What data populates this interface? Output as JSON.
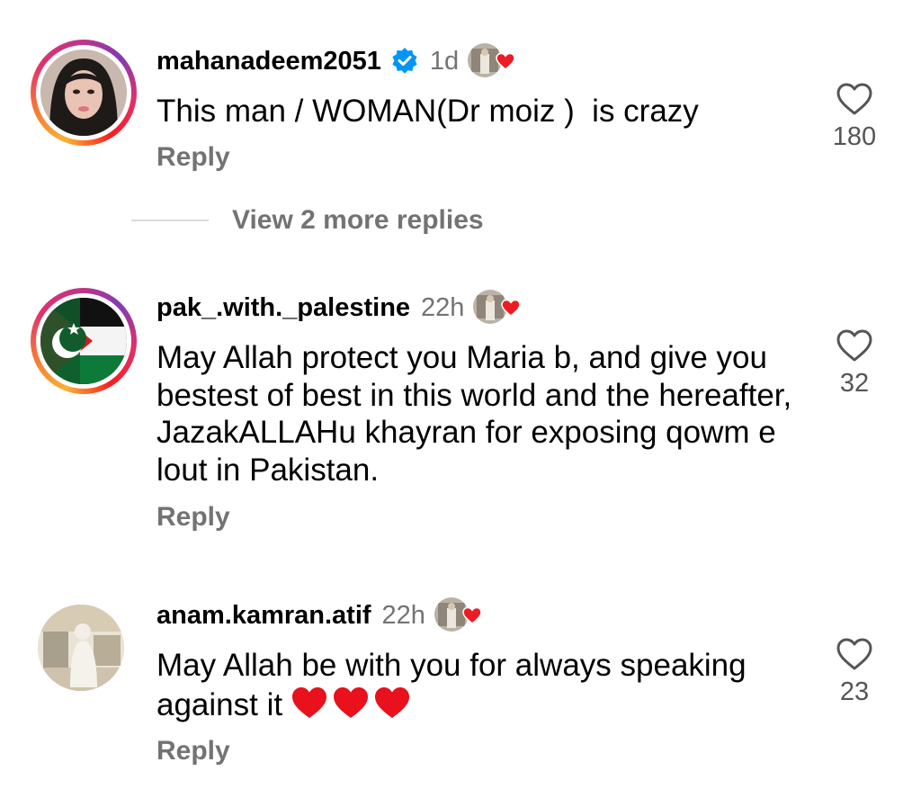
{
  "comments": [
    {
      "username": "mahanadeem2051",
      "verified": true,
      "time": "1d",
      "text": "This man / WOMAN(Dr moiz )  is crazy",
      "emoji": "",
      "reply_label": "Reply",
      "likes": "180",
      "avatar_style": "ring"
    },
    {
      "username": "pak_.with._palestine",
      "verified": false,
      "time": "22h",
      "text": "May Allah protect you Maria b, and give you bestest of best in this world and the hereafter,  JazakALLAHu khayran for exposing qowm e lout in Pakistan.",
      "emoji": "",
      "reply_label": "Reply",
      "likes": "32",
      "avatar_style": "ring"
    },
    {
      "username": "anam.kamran.atif",
      "verified": false,
      "time": "22h",
      "text": "May Allah be with you for always speaking against it",
      "emoji": "❤❤❤",
      "reply_label": "Reply",
      "likes": "23",
      "avatar_style": "plain"
    }
  ],
  "view_more_replies": "View 2 more replies",
  "colors": {
    "muted": "#737373",
    "verified_blue": "#0095f6",
    "heart_red": "#ed1c24",
    "divider": "#dbdbdb"
  },
  "icons": {
    "like": "heart-outline-icon",
    "verified": "verified-badge-icon",
    "author_liked": "author-liked-heart-icon"
  }
}
